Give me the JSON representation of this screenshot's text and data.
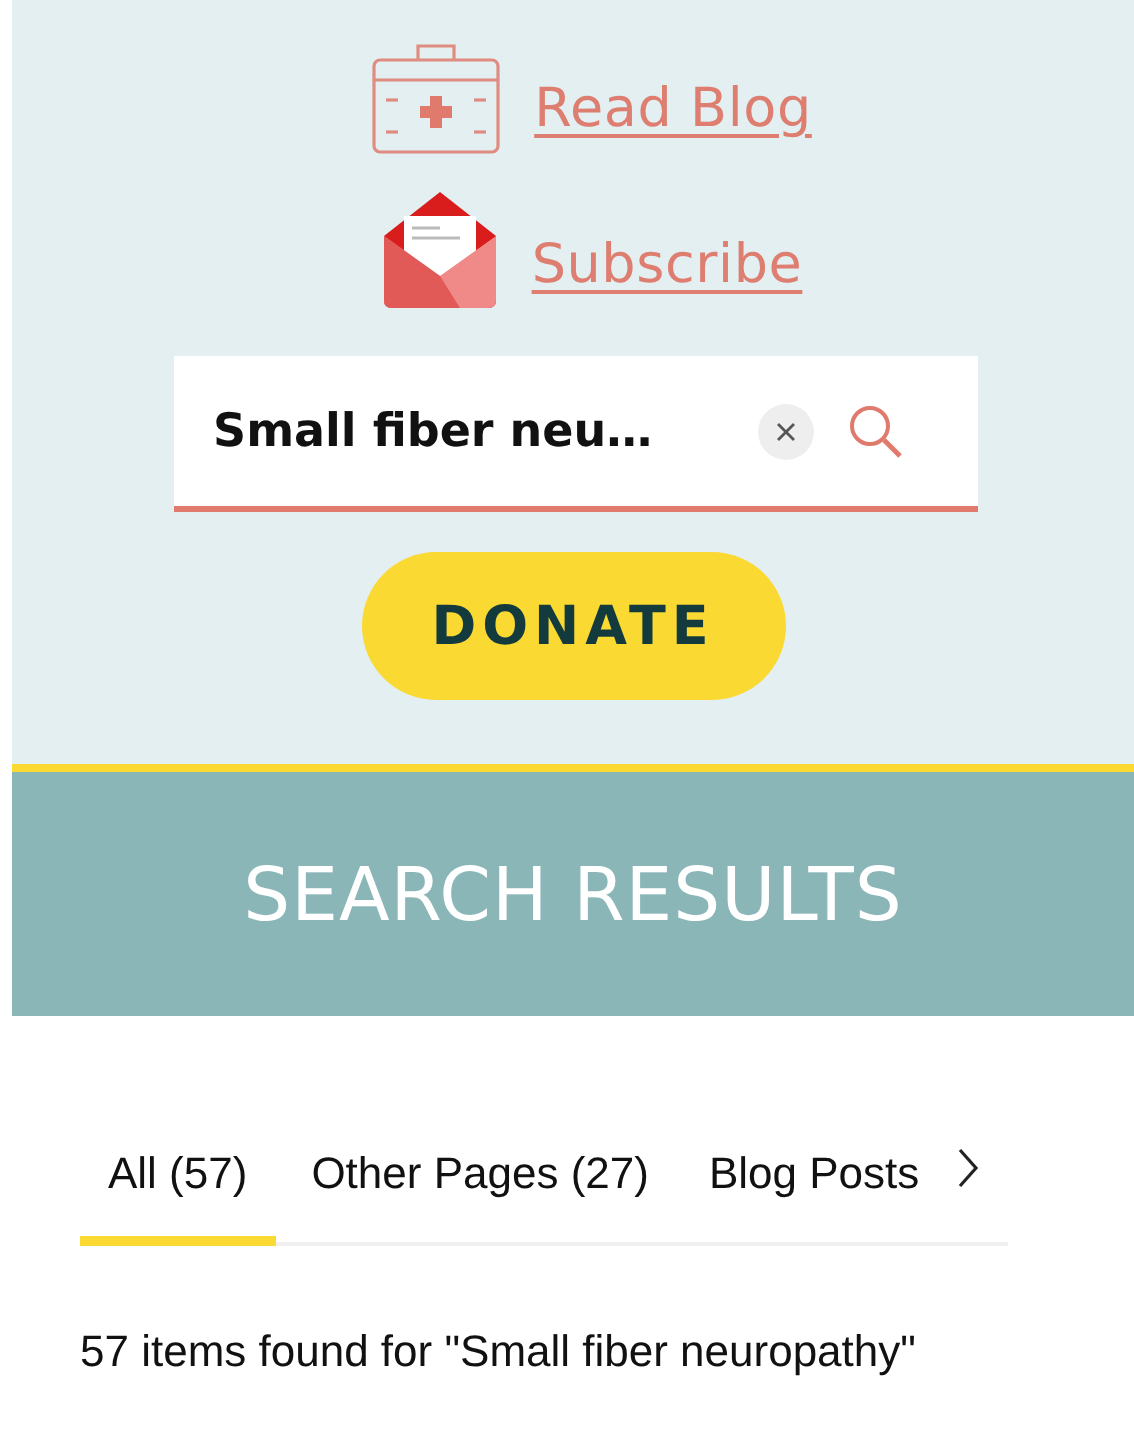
{
  "links": [
    {
      "kind": "medkit",
      "label": "Read Blog"
    },
    {
      "kind": "envelope",
      "label": "Subscribe"
    }
  ],
  "search": {
    "value": "Small fiber neu…"
  },
  "donate_button": "DONATE",
  "banner": {
    "title": "SEARCH RESULTS"
  },
  "tabs": [
    {
      "label": "All (57)",
      "selected": true
    },
    {
      "label": "Other Pages (27)",
      "selected": false
    },
    {
      "label": "Blog Posts",
      "selected": false
    }
  ],
  "results_summary": "57 items found for \"Small fiber neuropathy\""
}
